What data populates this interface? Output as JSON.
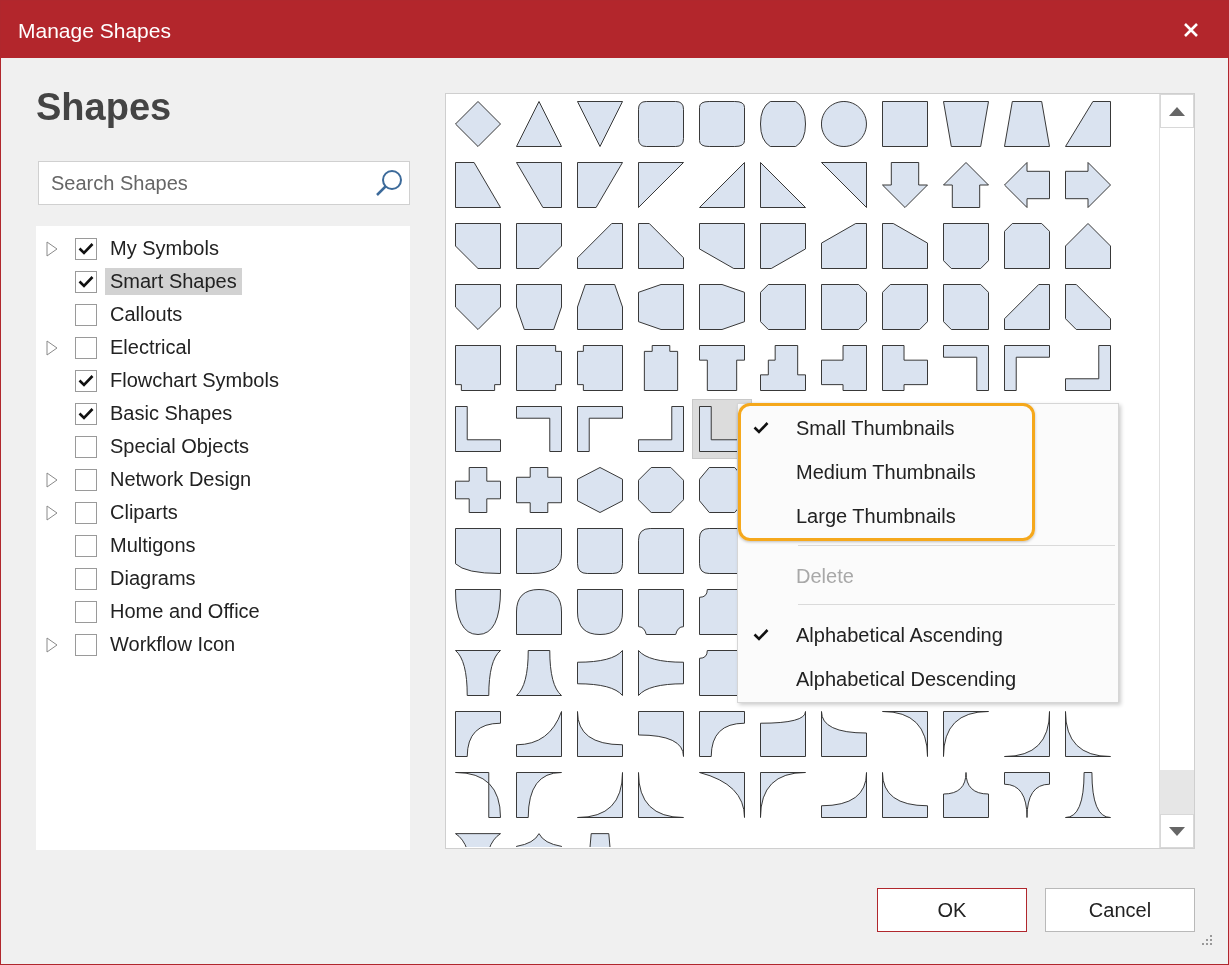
{
  "window": {
    "title": "Manage Shapes"
  },
  "heading": "Shapes",
  "search": {
    "placeholder": "Search Shapes"
  },
  "tree": [
    {
      "label": "My Symbols",
      "checked": true,
      "expandable": true,
      "selected": false
    },
    {
      "label": "Smart Shapes",
      "checked": true,
      "expandable": false,
      "selected": true
    },
    {
      "label": "Callouts",
      "checked": false,
      "expandable": false,
      "selected": false
    },
    {
      "label": "Electrical",
      "checked": false,
      "expandable": true,
      "selected": false
    },
    {
      "label": "Flowchart Symbols",
      "checked": true,
      "expandable": false,
      "selected": false
    },
    {
      "label": "Basic Shapes",
      "checked": true,
      "expandable": false,
      "selected": false
    },
    {
      "label": "Special Objects",
      "checked": false,
      "expandable": false,
      "selected": false
    },
    {
      "label": "Network Design",
      "checked": false,
      "expandable": true,
      "selected": false
    },
    {
      "label": "Cliparts",
      "checked": false,
      "expandable": true,
      "selected": false
    },
    {
      "label": "Multigons",
      "checked": false,
      "expandable": false,
      "selected": false
    },
    {
      "label": "Diagrams",
      "checked": false,
      "expandable": false,
      "selected": false
    },
    {
      "label": "Home and Office",
      "checked": false,
      "expandable": false,
      "selected": false
    },
    {
      "label": "Workflow Icon",
      "checked": false,
      "expandable": true,
      "selected": false
    }
  ],
  "shape_grid": {
    "rows": [
      {
        "cells": [
          {
            "selected": false
          },
          {
            "selected": false
          },
          {
            "selected": false
          },
          {
            "selected": false
          },
          {
            "selected": false
          },
          {
            "selected": false
          },
          {
            "selected": false
          },
          {
            "selected": false
          },
          {
            "selected": false
          },
          {
            "selected": false
          },
          {
            "selected": false
          }
        ]
      },
      {
        "cells": [
          {
            "selected": false
          },
          {
            "selected": false
          },
          {
            "selected": false
          },
          {
            "selected": false
          },
          {
            "selected": false
          },
          {
            "selected": false
          },
          {
            "selected": false
          },
          {
            "selected": false
          },
          {
            "selected": false
          },
          {
            "selected": false
          },
          {
            "selected": false
          }
        ]
      },
      {
        "cells": [
          {
            "selected": false
          },
          {
            "selected": false
          },
          {
            "selected": false
          },
          {
            "selected": false
          },
          {
            "selected": false
          },
          {
            "selected": false
          },
          {
            "selected": false
          },
          {
            "selected": false
          },
          {
            "selected": false
          },
          {
            "selected": false
          },
          {
            "selected": false
          }
        ]
      },
      {
        "cells": [
          {
            "selected": false
          },
          {
            "selected": false
          },
          {
            "selected": false
          },
          {
            "selected": false
          },
          {
            "selected": false
          },
          {
            "selected": false
          },
          {
            "selected": false
          },
          {
            "selected": false
          },
          {
            "selected": false
          },
          {
            "selected": false
          },
          {
            "selected": false
          }
        ]
      },
      {
        "cells": [
          {
            "selected": false
          },
          {
            "selected": false
          },
          {
            "selected": false
          },
          {
            "selected": false
          },
          {
            "selected": false
          },
          {
            "selected": false
          },
          {
            "selected": false
          },
          {
            "selected": false
          },
          {
            "selected": false
          },
          {
            "selected": false
          },
          {
            "selected": false
          }
        ]
      },
      {
        "cells": [
          {
            "selected": false
          },
          {
            "selected": false
          },
          {
            "selected": false
          },
          {
            "selected": false
          },
          {
            "selected": true
          }
        ]
      },
      {
        "cells": [
          {
            "selected": false
          },
          {
            "selected": false
          },
          {
            "selected": false
          },
          {
            "selected": false
          },
          {
            "selected": false
          }
        ]
      },
      {
        "cells": [
          {
            "selected": false
          },
          {
            "selected": false
          },
          {
            "selected": false
          },
          {
            "selected": false
          },
          {
            "selected": false
          }
        ]
      },
      {
        "cells": [
          {
            "selected": false
          },
          {
            "selected": false
          },
          {
            "selected": false
          },
          {
            "selected": false
          },
          {
            "selected": false
          }
        ]
      },
      {
        "cells": [
          {
            "selected": false
          },
          {
            "selected": false
          },
          {
            "selected": false
          },
          {
            "selected": false
          },
          {
            "selected": false
          }
        ]
      },
      {
        "cells": [
          {
            "selected": false
          },
          {
            "selected": false
          },
          {
            "selected": false
          },
          {
            "selected": false
          },
          {
            "selected": false
          },
          {
            "selected": false
          },
          {
            "selected": false
          },
          {
            "selected": false
          },
          {
            "selected": false
          },
          {
            "selected": false
          },
          {
            "selected": false
          }
        ]
      },
      {
        "cells": [
          {
            "selected": false
          },
          {
            "selected": false
          },
          {
            "selected": false
          },
          {
            "selected": false
          },
          {
            "selected": false
          },
          {
            "selected": false
          },
          {
            "selected": false
          },
          {
            "selected": false
          },
          {
            "selected": false
          },
          {
            "selected": false
          },
          {
            "selected": false
          }
        ]
      },
      {
        "cells": [
          {
            "selected": false
          },
          {
            "selected": false
          },
          {
            "selected": false
          }
        ]
      }
    ]
  },
  "context_menu": {
    "groups": [
      {
        "highlighted": true,
        "items": [
          {
            "label": "Small Thumbnails",
            "checked": true,
            "disabled": false
          },
          {
            "label": "Medium Thumbnails",
            "checked": false,
            "disabled": false
          },
          {
            "label": "Large Thumbnails",
            "checked": false,
            "disabled": false
          }
        ]
      },
      {
        "highlighted": false,
        "items": [
          {
            "label": "Delete",
            "checked": false,
            "disabled": true
          }
        ]
      },
      {
        "highlighted": false,
        "items": [
          {
            "label": "Alphabetical Ascending",
            "checked": true,
            "disabled": false
          },
          {
            "label": "Alphabetical Descending",
            "checked": false,
            "disabled": false
          }
        ]
      }
    ]
  },
  "buttons": [
    {
      "label": "OK",
      "default": true
    },
    {
      "label": "Cancel",
      "default": false
    }
  ]
}
